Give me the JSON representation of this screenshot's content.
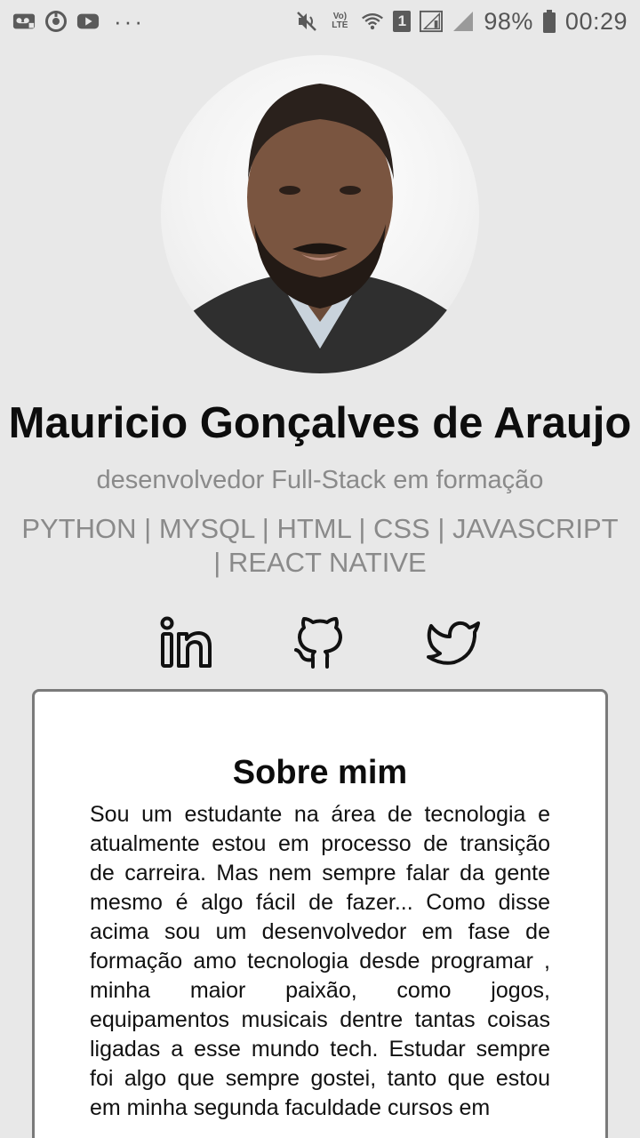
{
  "status_bar": {
    "left_icons": [
      "voicemail-icon",
      "sync-icon",
      "youtube-icon",
      "more-dots-icon"
    ],
    "more": "···",
    "right_icons": [
      "mute-icon",
      "volte-icon",
      "wifi-icon",
      "sim1-icon",
      "signal-icon",
      "signal-icon-2",
      "battery-icon"
    ],
    "volte_label": "Vo) LTE",
    "sim_label": "1",
    "battery": "98%",
    "time": "00:29"
  },
  "profile": {
    "name": "Mauricio Gonçalves de Araujo",
    "subtitle": "desenvolvedor Full-Stack em formação",
    "skills": "PYTHON | MYSQL | HTML | CSS | JAVASCRIPT | REACT NATIVE"
  },
  "social": {
    "items": [
      "linkedin-icon",
      "github-icon",
      "twitter-icon"
    ]
  },
  "about": {
    "title": "Sobre mim",
    "text": "Sou um estudante na área de tecnologia e atualmente estou em processo de transição de carreira. Mas nem sempre falar da gente mesmo é algo fácil de fazer... Como disse acima sou um desenvolvedor em fase de formação amo tecnologia desde programar , minha maior paixão, como jogos, equipamentos musicais dentre tantas coisas ligadas a esse mundo tech. Estudar sempre foi algo que sempre gostei, tanto que estou em minha segunda faculdade cursos em"
  },
  "colors": {
    "background": "#e8e8e8",
    "muted_text": "#8a8a8a",
    "card_border": "#7a7a7a"
  }
}
